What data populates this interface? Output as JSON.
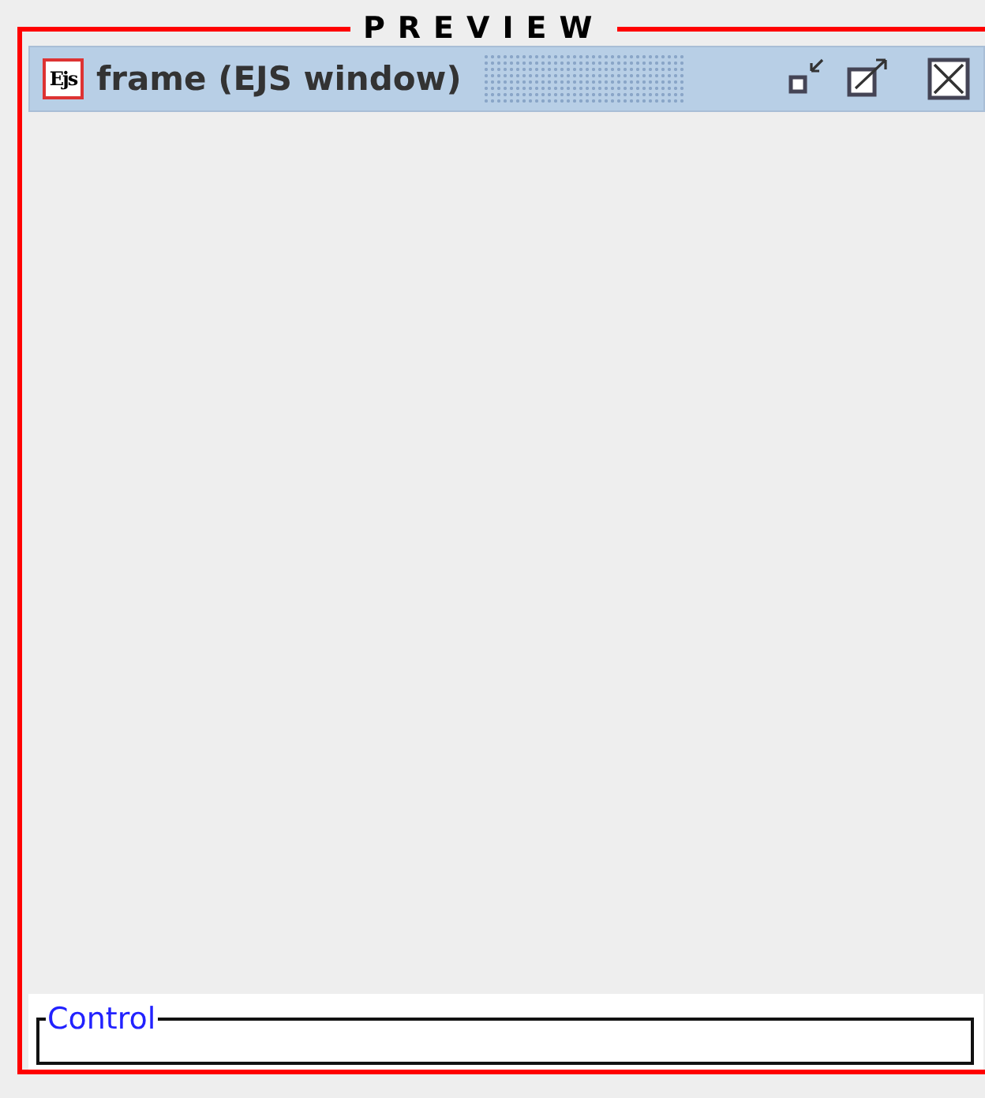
{
  "preview": {
    "title": "PREVIEW"
  },
  "frame": {
    "logo": "Ejs",
    "title": "frame (EJS window)"
  },
  "control_panel": {
    "title": "Control"
  }
}
